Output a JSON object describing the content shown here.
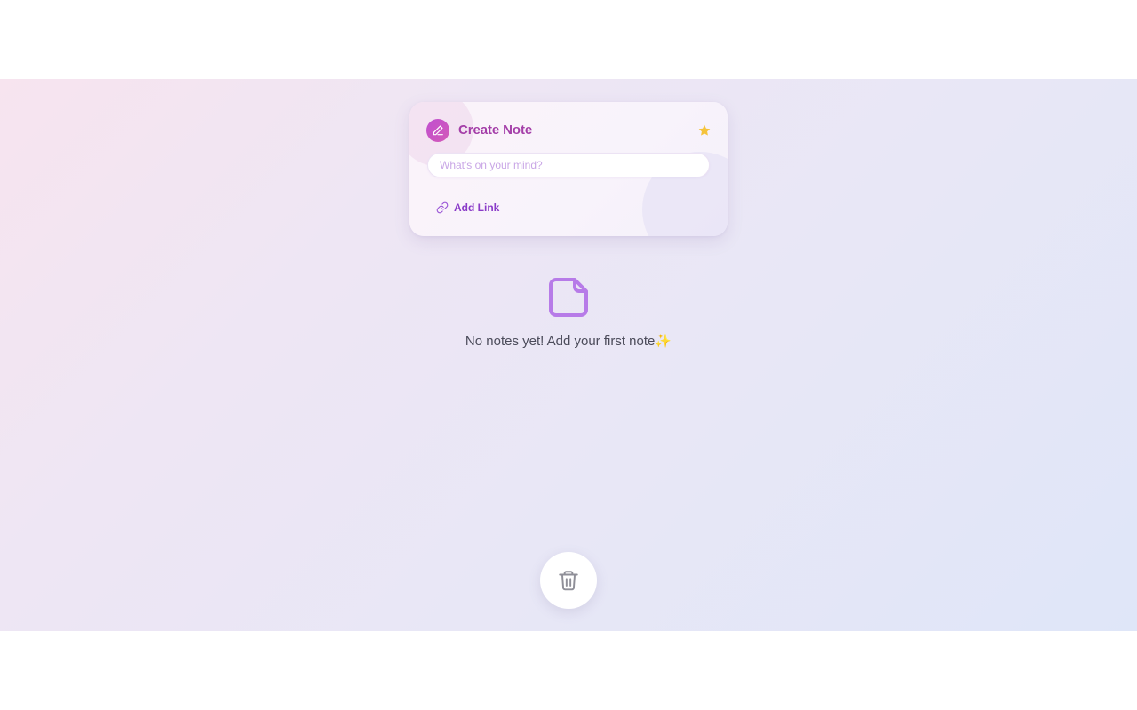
{
  "create_card": {
    "title": "Create Note",
    "title_icon": "pen-icon",
    "favorite_icon": "star-icon",
    "input": {
      "value": "",
      "placeholder": "What's on your mind?"
    },
    "add_link": {
      "label": "Add Link",
      "icon": "link-icon"
    }
  },
  "empty_state": {
    "icon": "note-icon",
    "message": "No notes yet! Add your first note✨"
  },
  "trash": {
    "icon": "trash-icon"
  },
  "colors": {
    "accent": "#a43ea8",
    "star": "#f5c33b",
    "link": "#8a3bc8",
    "empty_icon": "#b77be8"
  }
}
